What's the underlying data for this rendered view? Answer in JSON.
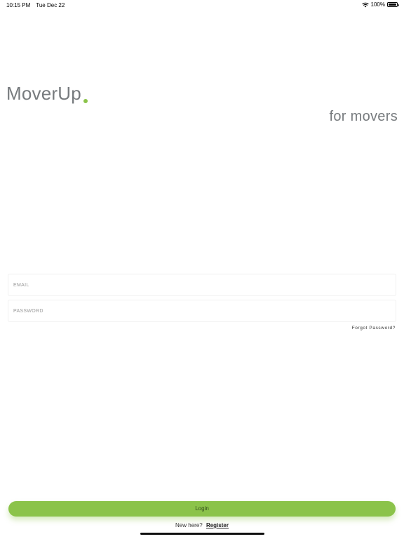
{
  "status_bar": {
    "time": "10:15 PM",
    "date": "Tue Dec 22",
    "battery": "100%",
    "battery_level": 1.0,
    "icons": [
      "wifi-icon",
      "battery-icon"
    ]
  },
  "brand": {
    "name": "MoverUp",
    "tagline": "for movers",
    "accent_color": "#8bc34a",
    "text_color": "#777b7e"
  },
  "form": {
    "email_placeholder": "EMAIL",
    "email_value": "",
    "password_placeholder": "PASSWORD",
    "password_value": "",
    "forgot_label": "Forgot Password?"
  },
  "actions": {
    "login_label": "Login",
    "new_here": "New here?",
    "register_label": "Register"
  }
}
